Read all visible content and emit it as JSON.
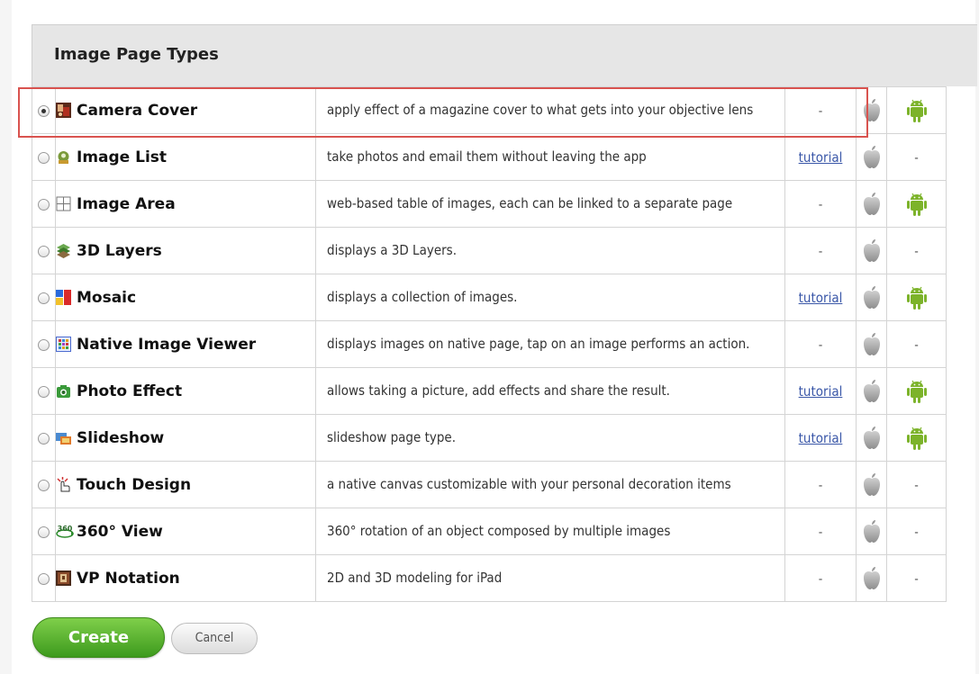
{
  "header": {
    "title": "Image Page Types"
  },
  "rows": [
    {
      "name": "Camera Cover",
      "icon": "camera-cover-icon",
      "description": "apply effect of a magazine cover to what gets into your objective lens",
      "tutorial": "-",
      "android": true,
      "selected": true
    },
    {
      "name": "Image List",
      "icon": "image-list-icon",
      "description": "take photos and email them without leaving the app",
      "tutorial": "tutorial",
      "android": false,
      "selected": false
    },
    {
      "name": "Image Area",
      "icon": "image-area-icon",
      "description": "web-based table of images, each can be linked to a separate page",
      "tutorial": "-",
      "android": true,
      "selected": false
    },
    {
      "name": "3D Layers",
      "icon": "3d-layers-icon",
      "description": "displays a 3D Layers.",
      "tutorial": "-",
      "android": false,
      "selected": false
    },
    {
      "name": "Mosaic",
      "icon": "mosaic-icon",
      "description": "displays a collection of images.",
      "tutorial": "tutorial",
      "android": true,
      "selected": false
    },
    {
      "name": "Native Image Viewer",
      "icon": "native-image-viewer-icon",
      "description": "displays images on native page, tap on an image performs an action.",
      "tutorial": "-",
      "android": false,
      "selected": false
    },
    {
      "name": "Photo Effect",
      "icon": "photo-effect-icon",
      "description": "allows taking a picture, add effects and share the result.",
      "tutorial": "tutorial",
      "android": true,
      "selected": false
    },
    {
      "name": "Slideshow",
      "icon": "slideshow-icon",
      "description": "slideshow page type.",
      "tutorial": "tutorial",
      "android": true,
      "selected": false
    },
    {
      "name": "Touch Design",
      "icon": "touch-design-icon",
      "description": "a native canvas customizable with your personal decoration items",
      "tutorial": "-",
      "android": false,
      "selected": false
    },
    {
      "name": "360° View",
      "icon": "360-view-icon",
      "description": "360° rotation of an object composed by multiple images",
      "tutorial": "-",
      "android": false,
      "selected": false
    },
    {
      "name": "VP Notation",
      "icon": "vp-notation-icon",
      "description": "2D and 3D modeling for iPad",
      "tutorial": "-",
      "android": false,
      "selected": false
    }
  ],
  "unavailable_mark": "-",
  "platform_icons": {
    "ios": "apple-icon",
    "android": "android-icon"
  },
  "colors": {
    "android": "#7cb32a",
    "apple": "#a8a8a8",
    "link": "#3a57a8",
    "highlight": "#d9534f",
    "create": "#4aa624"
  },
  "actions": {
    "create_label": "Create",
    "cancel_label": "Cancel"
  }
}
